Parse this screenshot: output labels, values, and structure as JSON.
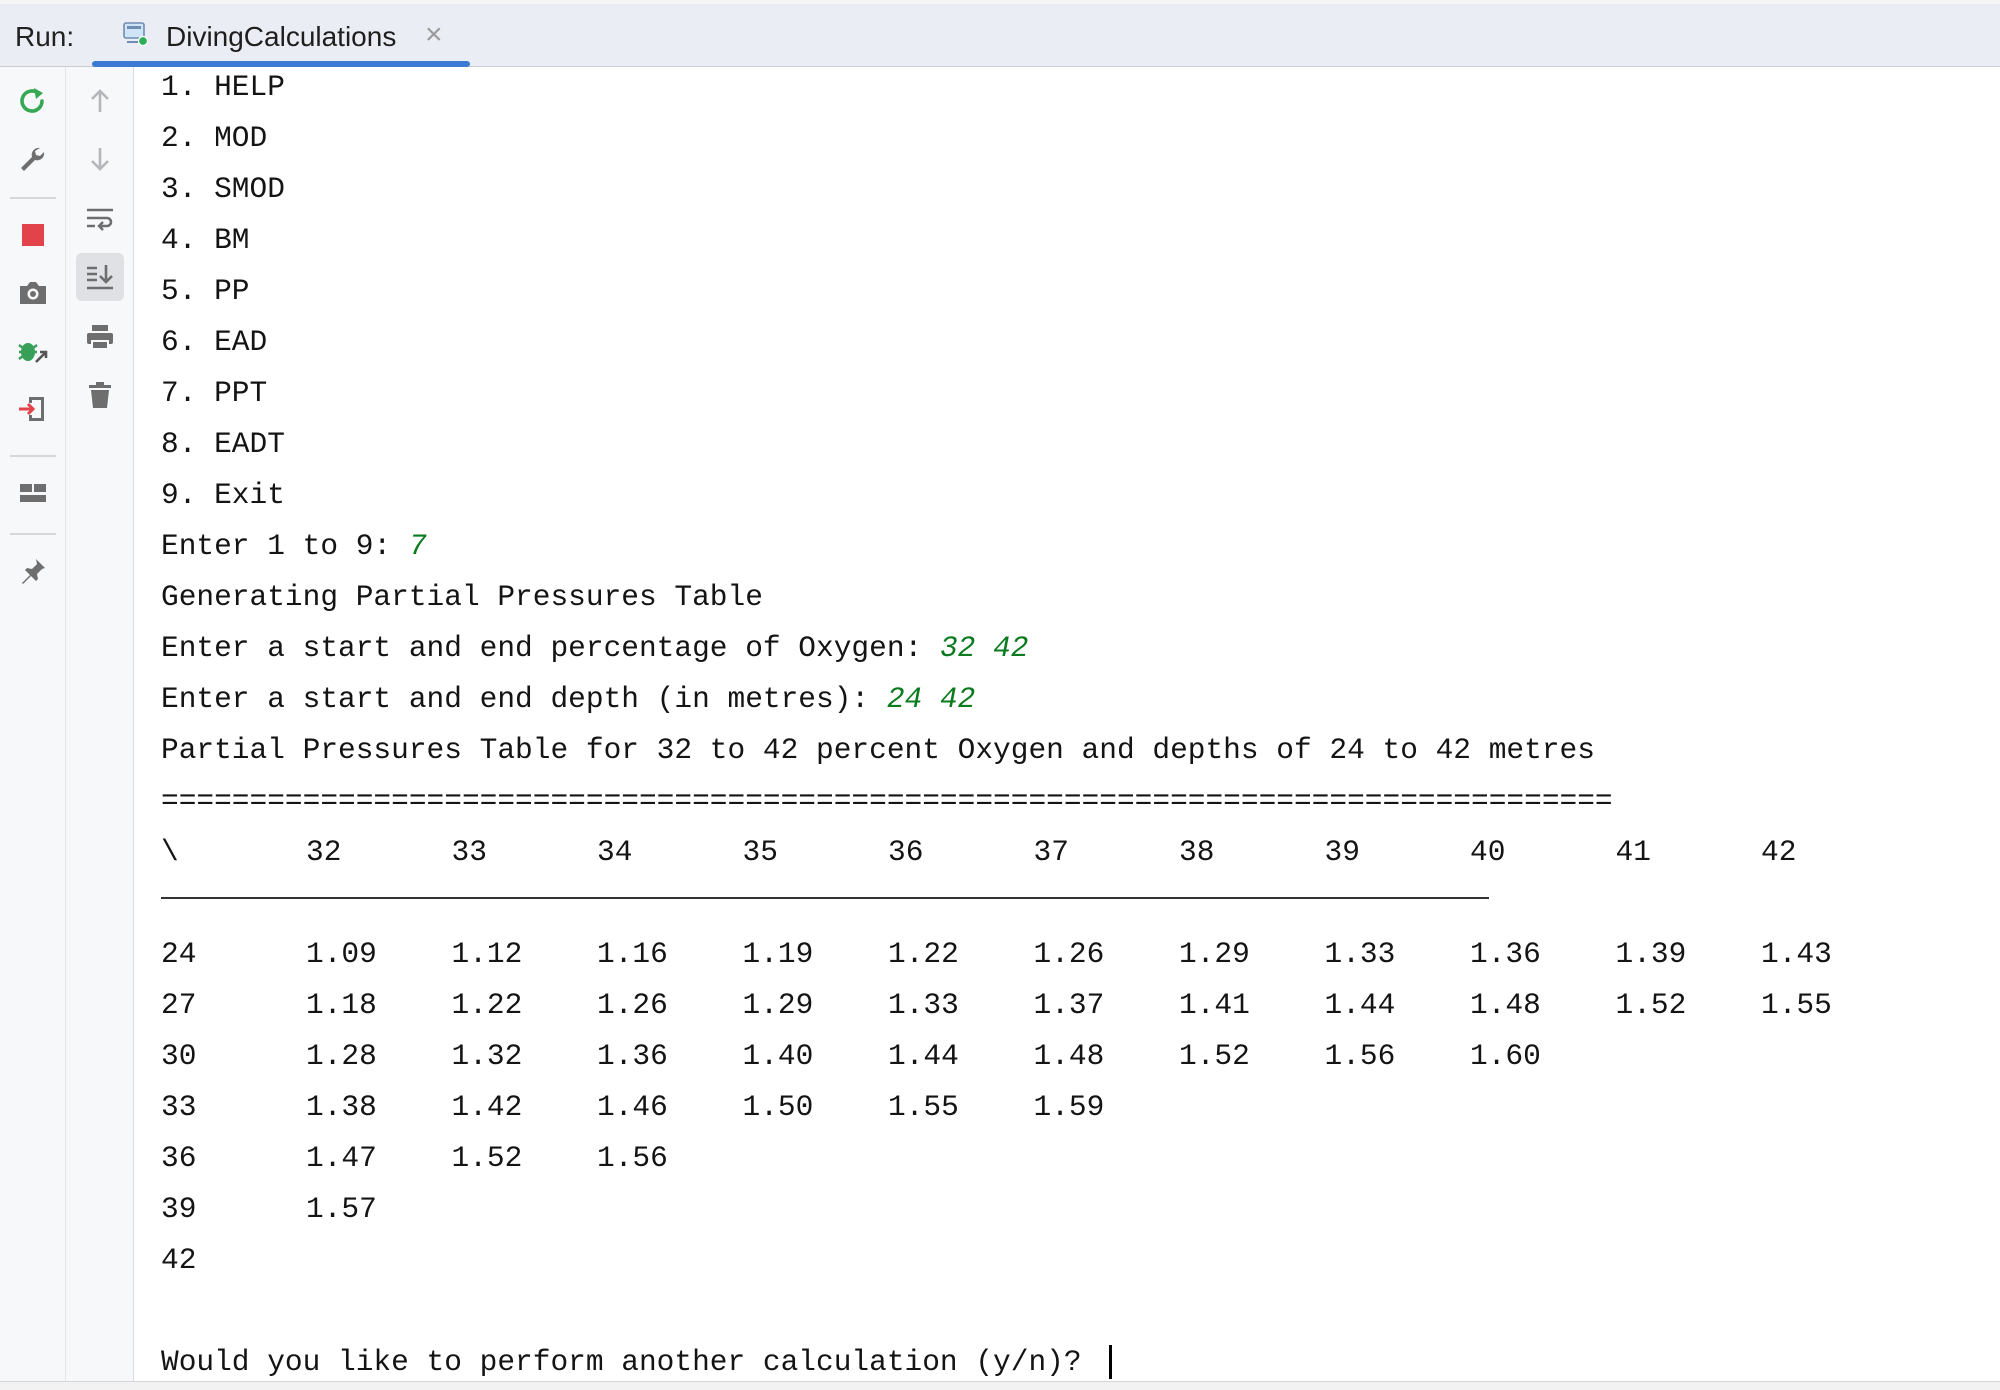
{
  "header": {
    "run_label": "Run:",
    "tab_title": "DivingCalculations",
    "close_glyph": "×",
    "tab_icon": "run-config-icon"
  },
  "toolbar_primary": [
    "rerun-icon",
    "wrench-icon",
    "stop-icon",
    "camera-icon",
    "debug-swap-icon",
    "exit-to-icon",
    "layout-icon",
    "pin-icon"
  ],
  "toolbar_secondary": [
    "up-arrow-icon",
    "down-arrow-icon",
    "soft-wrap-icon",
    "scroll-to-end-icon",
    "print-icon",
    "trash-icon"
  ],
  "console": {
    "menu": [
      "1. HELP",
      "2. MOD",
      "3. SMOD",
      "4. BM",
      "5. PP",
      "6. EAD",
      "7. PPT",
      "8. EADT",
      "9. Exit"
    ],
    "prompt_choice": "Enter 1 to 9: ",
    "input_choice": "7",
    "generating": "Generating Partial Pressures Table",
    "prompt_oxygen": "Enter a start and end percentage of Oxygen: ",
    "input_oxygen": "32 42",
    "prompt_depth": "Enter a start and end depth (in metres): ",
    "input_depth": "24 42",
    "table_title": "Partial Pressures Table for 32 to 42 percent Oxygen and depths of 24 to 42 metres",
    "separator": "==================================================================================",
    "corner": "\\",
    "columns": [
      "32",
      "33",
      "34",
      "35",
      "36",
      "37",
      "38",
      "39",
      "40",
      "41",
      "42"
    ],
    "rows": [
      {
        "depth": "24",
        "values": [
          "1.09",
          "1.12",
          "1.16",
          "1.19",
          "1.22",
          "1.26",
          "1.29",
          "1.33",
          "1.36",
          "1.39",
          "1.43"
        ]
      },
      {
        "depth": "27",
        "values": [
          "1.18",
          "1.22",
          "1.26",
          "1.29",
          "1.33",
          "1.37",
          "1.41",
          "1.44",
          "1.48",
          "1.52",
          "1.55"
        ]
      },
      {
        "depth": "30",
        "values": [
          "1.28",
          "1.32",
          "1.36",
          "1.40",
          "1.44",
          "1.48",
          "1.52",
          "1.56",
          "1.60"
        ]
      },
      {
        "depth": "33",
        "values": [
          "1.38",
          "1.42",
          "1.46",
          "1.50",
          "1.55",
          "1.59"
        ]
      },
      {
        "depth": "36",
        "values": [
          "1.47",
          "1.52",
          "1.56"
        ]
      },
      {
        "depth": "39",
        "values": [
          "1.57"
        ]
      },
      {
        "depth": "42",
        "values": []
      }
    ],
    "final_prompt": "Would you like to perform another calculation (y/n)? "
  }
}
